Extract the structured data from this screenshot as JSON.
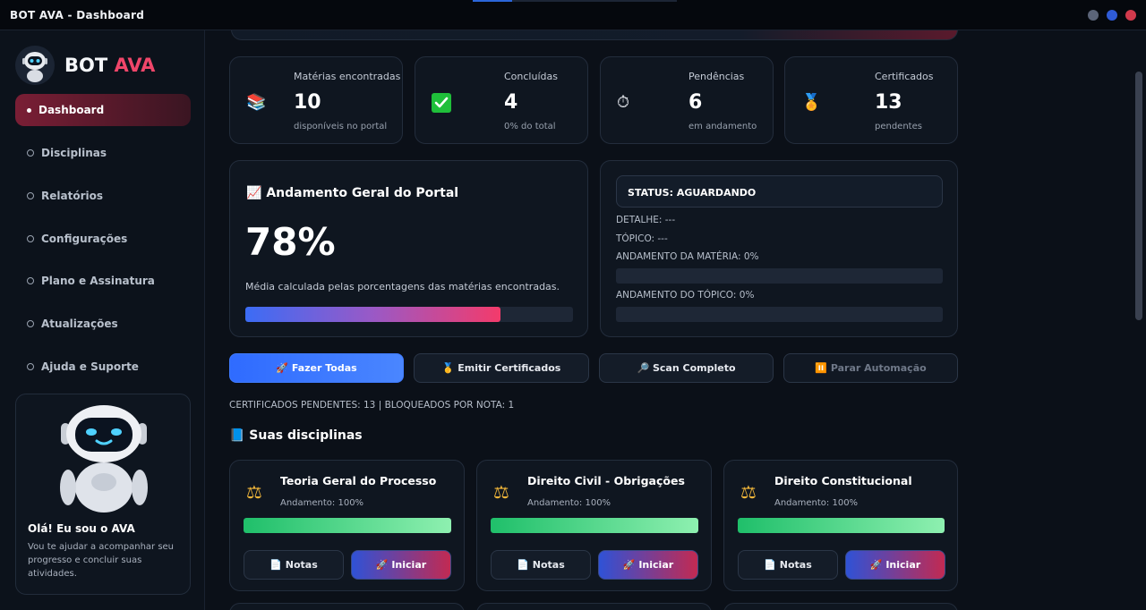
{
  "window": {
    "title": "BOT AVA - Dashboard"
  },
  "brand": {
    "name_main": "BOT",
    "name_accent": "AVA"
  },
  "sidebar": {
    "items": [
      {
        "label": "Dashboard",
        "active": true
      },
      {
        "label": "Disciplinas"
      },
      {
        "label": "Relatórios"
      },
      {
        "label": "Configurações"
      },
      {
        "label": "Plano e Assinatura"
      },
      {
        "label": "Atualizações"
      },
      {
        "label": "Ajuda e Suporte"
      }
    ],
    "helper": {
      "title": "Olá! Eu sou o AVA",
      "text": "Vou te ajudar a acompanhar seu progresso e concluir suas atividades."
    }
  },
  "stats": [
    {
      "label": "Matérias encontradas",
      "value": "10",
      "sub": "disponíveis no portal",
      "icon": "books-icon"
    },
    {
      "label": "Concluídas",
      "value": "4",
      "sub": "0% do total",
      "icon": "check-icon"
    },
    {
      "label": "Pendências",
      "value": "6",
      "sub": "em andamento",
      "icon": "stopwatch-icon"
    },
    {
      "label": "Certificados",
      "value": "13",
      "sub": "pendentes",
      "icon": "medal-icon"
    }
  ],
  "overall": {
    "title": "Andamento Geral do Portal",
    "value": "78%",
    "percent": 78,
    "description": "Média calculada pelas porcentagens das matérias encontradas."
  },
  "status": {
    "header": "STATUS: AGUARDANDO",
    "detail": "DETALHE: ---",
    "topic": "TÓPICO: ---",
    "subject_progress": "ANDAMENTO DA MATÉRIA: 0%",
    "subject_percent": 0,
    "topic_progress": "ANDAMENTO DO TÓPICO: 0%",
    "topic_percent": 0
  },
  "actions": {
    "do_all": "🚀 Fazer Todas",
    "issue_certs": "🥇 Emitir Certificados",
    "full_scan": "🔎 Scan Completo",
    "stop": "⏸️ Parar Automação"
  },
  "certificates_line": "CERTIFICADOS PENDENTES: 13 | BLOQUEADOS POR NOTA: 1",
  "disciplines_title": "📘 Suas disciplinas",
  "disciplines": [
    {
      "name": "Teoria Geral do Processo",
      "progress": "Andamento: 100%",
      "percent": 100,
      "notes": "📄 Notas",
      "start": "🚀 Iniciar"
    },
    {
      "name": "Direito Civil - Obrigações",
      "progress": "Andamento: 100%",
      "percent": 100,
      "notes": "📄 Notas",
      "start": "🚀 Iniciar"
    },
    {
      "name": "Direito Constitucional",
      "progress": "Andamento: 100%",
      "percent": 100,
      "notes": "📄 Notas",
      "start": "🚀 Iniciar"
    }
  ],
  "colors": {
    "accent": "#f0466a",
    "primary": "#2f6bff",
    "success": "#1fbf6a"
  }
}
